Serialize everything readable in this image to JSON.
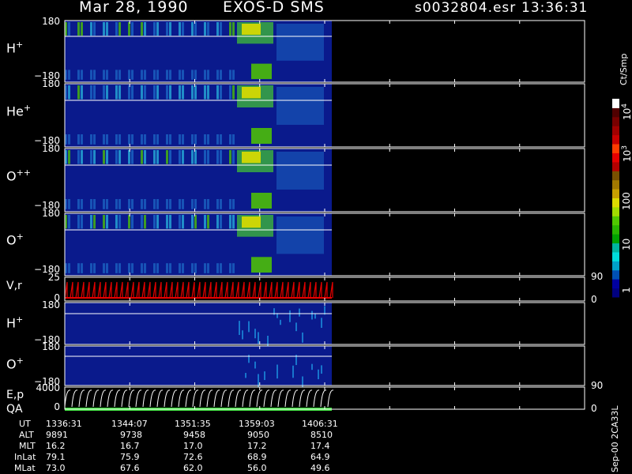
{
  "header": {
    "date": "Mar 28, 1990",
    "instrument": "EXOS-D SMS",
    "file": "s0032804.esr",
    "time": "13:36:31"
  },
  "colorbar": {
    "unit_label": "Ct/Smp",
    "ticks": [
      "1",
      "10",
      "100",
      "10",
      "10"
    ],
    "tick_powers": [
      "",
      "",
      "",
      "3",
      "4"
    ],
    "colors": [
      "#000080",
      "#0000a0",
      "#0050b4",
      "#00a0c8",
      "#00dcdc",
      "#00b4a0",
      "#00a000",
      "#28b400",
      "#50c800",
      "#a0dc00",
      "#dcdc00",
      "#c8a000",
      "#a07800",
      "#785000",
      "#b40000",
      "#e60000",
      "#ff3c00",
      "#c80000",
      "#a00000",
      "#780000",
      "#500000",
      "#ffffff"
    ]
  },
  "footer_note": "Sep-00 2CA33L",
  "chart_data": {
    "type": "heatmap",
    "panels": [
      {
        "label": "H",
        "charge": "+",
        "ylim": [
          -180,
          180
        ],
        "ytick_top": "180",
        "ytick_bottom": "−180"
      },
      {
        "label": "He",
        "charge": "+",
        "ylim": [
          -180,
          180
        ],
        "ytick_top": "180",
        "ytick_bottom": "−180"
      },
      {
        "label": "O",
        "charge": "++",
        "ylim": [
          -180,
          180
        ],
        "ytick_top": "180",
        "ytick_bottom": "−180"
      },
      {
        "label": "O",
        "charge": "+",
        "ylim": [
          -180,
          180
        ],
        "ytick_top": "180",
        "ytick_bottom": "−180"
      },
      {
        "label": "V,r",
        "charge": "",
        "ylim": [
          0,
          25
        ],
        "ytick_top": "25",
        "ytick_bottom": "0",
        "right_top": "90",
        "right_bottom": "0"
      },
      {
        "label": "H",
        "charge": "+",
        "ylim": [
          -180,
          180
        ],
        "ytick_top": "180",
        "ytick_bottom": "−180"
      },
      {
        "label": "O",
        "charge": "+",
        "ylim": [
          -180,
          180
        ],
        "ytick_top": "180",
        "ytick_bottom": "−180"
      },
      {
        "label": "E,p",
        "label2": "QA",
        "charge": "",
        "ylim": [
          0,
          4000
        ],
        "ytick_top": "4000",
        "ytick_bottom": "0",
        "right_top": "90",
        "right_bottom": "0"
      }
    ],
    "time_axis": {
      "row_labels": [
        "UT",
        "ALT",
        "MLT",
        "InLat",
        "MLat"
      ],
      "columns": [
        [
          "1336:31",
          "9891",
          "16.2",
          "79.1",
          "73.0"
        ],
        [
          "1344:07",
          "9738",
          "16.7",
          "75.9",
          "67.6"
        ],
        [
          "1351:35",
          "9458",
          "17.0",
          "72.6",
          "62.0"
        ],
        [
          "1359:03",
          "9050",
          "17.2",
          "68.9",
          "56.0"
        ],
        [
          "1406:31",
          "8510",
          "17.4",
          "64.9",
          "49.6"
        ]
      ]
    },
    "colorbar_scale": "log",
    "colorbar_range": [
      1,
      10000
    ]
  }
}
